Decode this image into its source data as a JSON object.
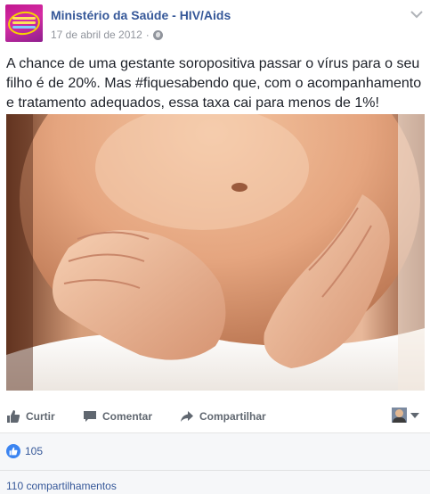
{
  "post": {
    "page_name": "Ministério da Saúde - HIV/Aids",
    "date": "17 de abril de 2012",
    "dot": "·",
    "text": "A chance de uma gestante soropositiva passar o vírus para o seu filho é de 20%. Mas #fiquesabendo que, com o acompanhamento e tratamento adequados, essa taxa cai para menos de 1%!",
    "image_alt": "Mãos sobre a barriga de uma gestante"
  },
  "actions": {
    "like_label": "Curtir",
    "comment_label": "Comentar",
    "share_label": "Compartilhar"
  },
  "footer": {
    "reactions_count": "105",
    "shares_text": "110 compartilhamentos"
  },
  "colors": {
    "link": "#365899",
    "muted": "#90949c",
    "action": "#606770",
    "like_badge": "#3b84f1"
  },
  "icons": {
    "header_menu": "chevron-down-icon",
    "privacy": "globe-icon",
    "like": "thumbs-up-icon",
    "comment": "speech-bubble-icon",
    "share": "share-arrow-icon"
  }
}
